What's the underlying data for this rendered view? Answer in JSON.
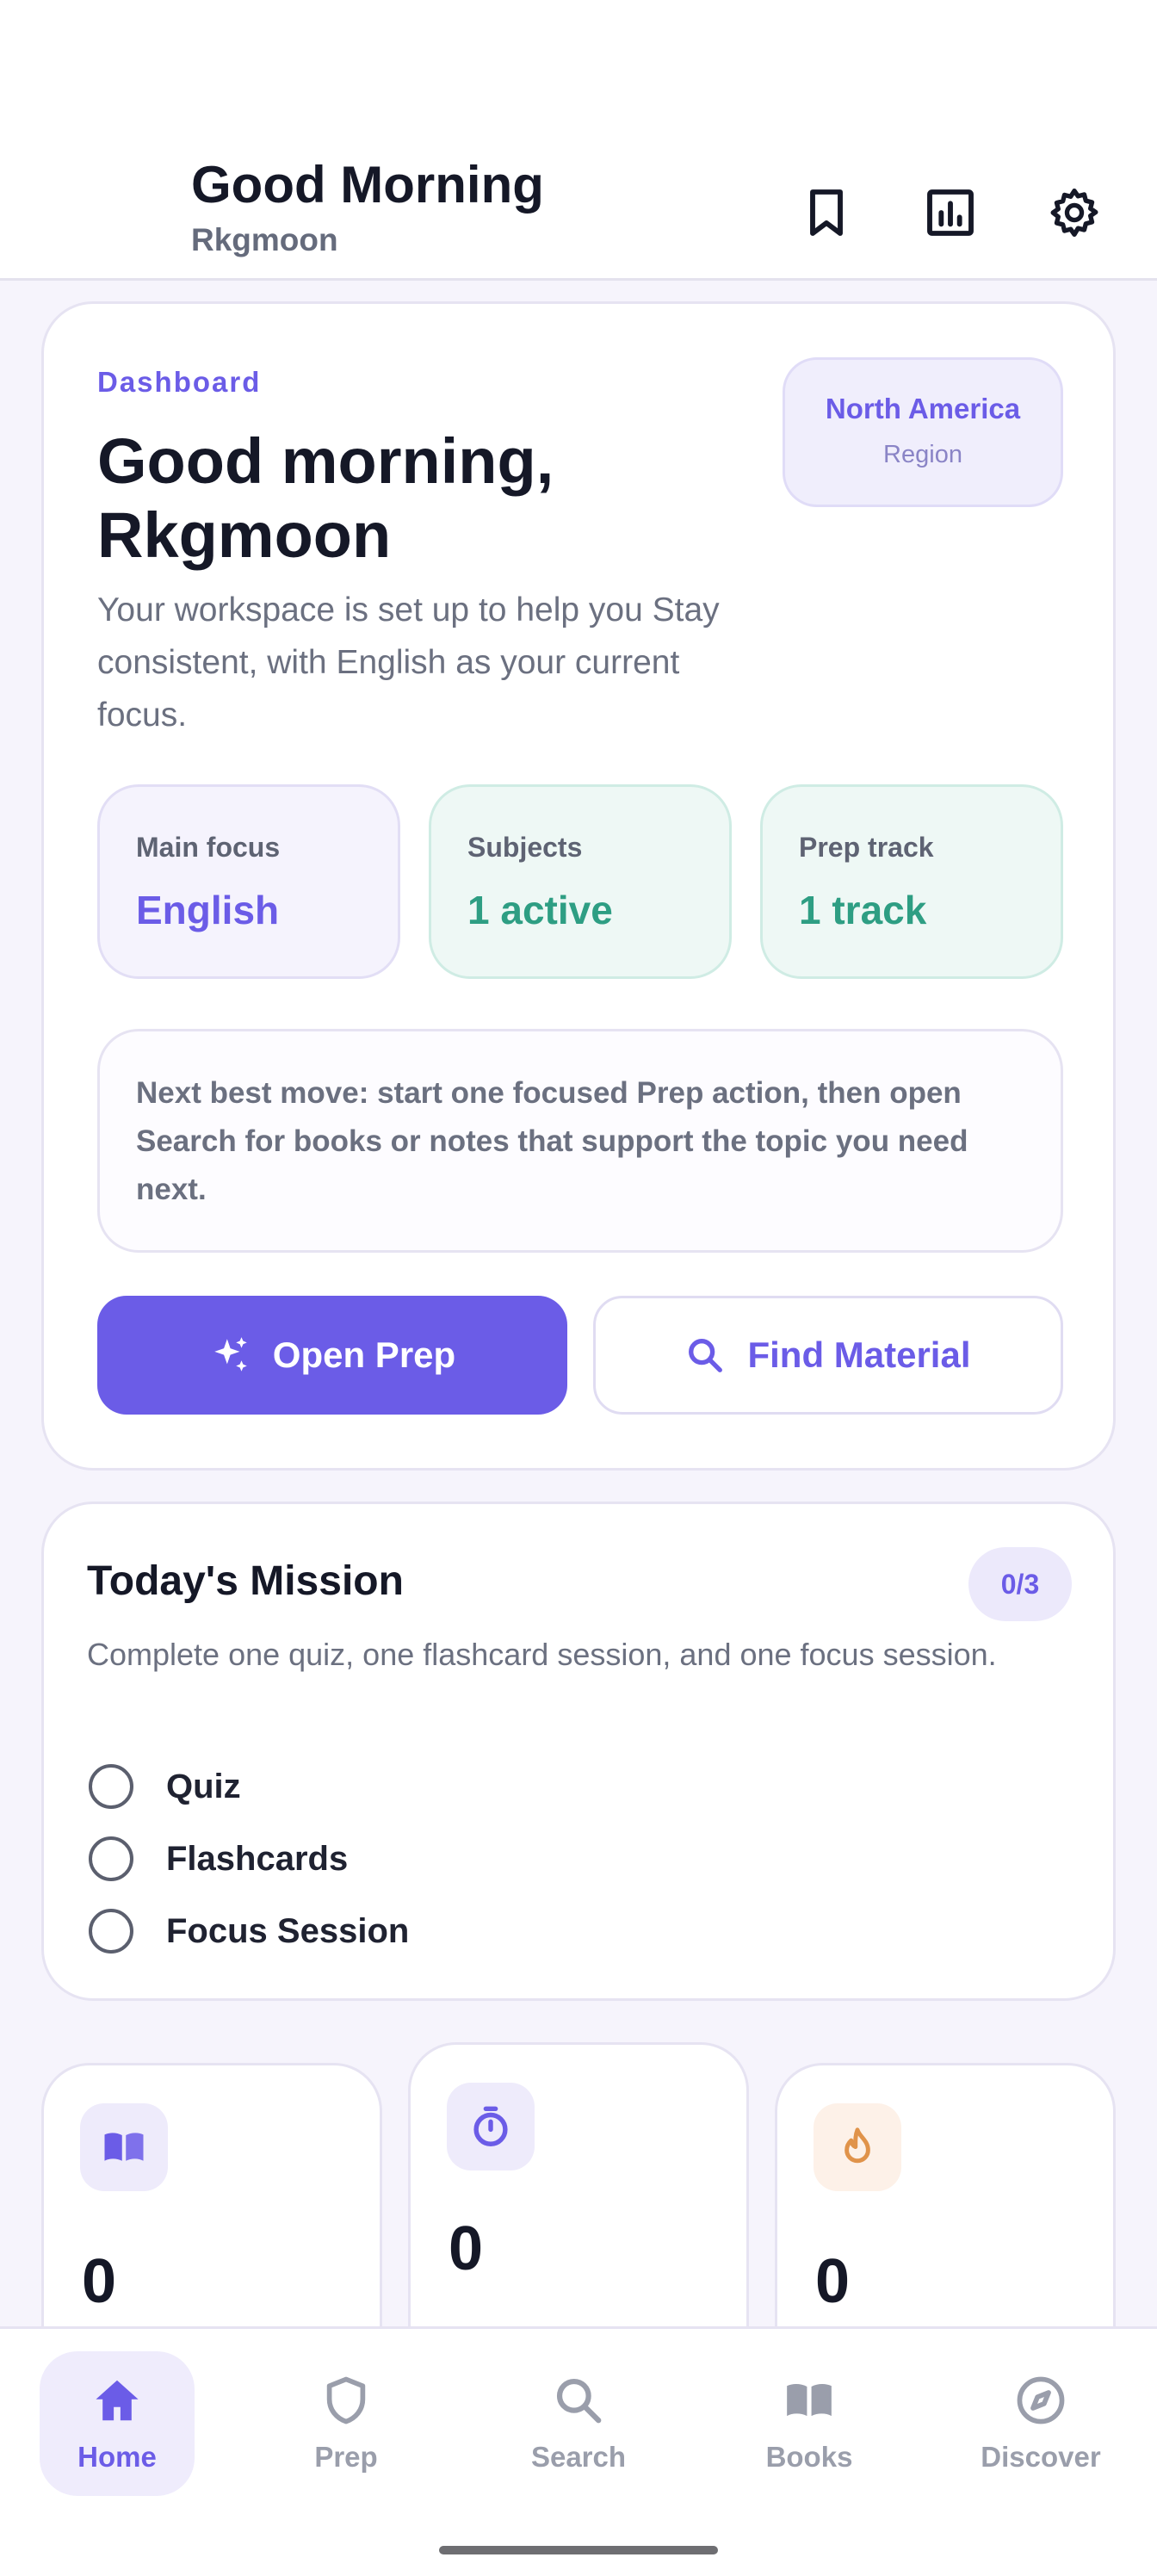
{
  "header": {
    "greeting": "Good Morning",
    "username": "Rkgmoon",
    "icons": [
      "bookmark-icon",
      "analytics-icon",
      "settings-icon"
    ]
  },
  "hero": {
    "overline": "Dashboard",
    "title": "Good morning, Rkgmoon",
    "description": "Your workspace is set up to help you Stay consistent, with English as your current focus.",
    "region": {
      "name": "North America",
      "label": "Region"
    },
    "stats": [
      {
        "label": "Main focus",
        "value": "English",
        "tone": "purple"
      },
      {
        "label": "Subjects",
        "value": "1 active",
        "tone": "green"
      },
      {
        "label": "Prep track",
        "value": "1 track",
        "tone": "green"
      }
    ],
    "tip": "Next best move: start one focused Prep action, then open Search for books or notes that support the topic you need next.",
    "primary_button": "Open Prep",
    "secondary_button": "Find Material"
  },
  "mission": {
    "title": "Today's Mission",
    "progress": "0/3",
    "description": "Complete one quiz, one flashcard session, and one focus session.",
    "items": [
      {
        "label": "Quiz",
        "done": false
      },
      {
        "label": "Flashcards",
        "done": false
      },
      {
        "label": "Focus Session",
        "done": false
      }
    ]
  },
  "stat_cards": [
    {
      "icon": "book-icon",
      "value": "0",
      "color": "#6b5ce7"
    },
    {
      "icon": "timer-icon",
      "value": "0",
      "color": "#6b5ce7"
    },
    {
      "icon": "flame-icon",
      "value": "0",
      "color": "#e0934a"
    }
  ],
  "bottom_nav": {
    "active": "Home",
    "items": [
      {
        "label": "Home",
        "icon": "home-icon"
      },
      {
        "label": "Prep",
        "icon": "shield-icon"
      },
      {
        "label": "Search",
        "icon": "search-icon"
      },
      {
        "label": "Books",
        "icon": "book-open-icon"
      },
      {
        "label": "Discover",
        "icon": "compass-icon"
      }
    ]
  },
  "colors": {
    "accent": "#6b5ce7",
    "green": "#2e9e83",
    "orange": "#e0934a",
    "background": "#f6f4fc"
  }
}
